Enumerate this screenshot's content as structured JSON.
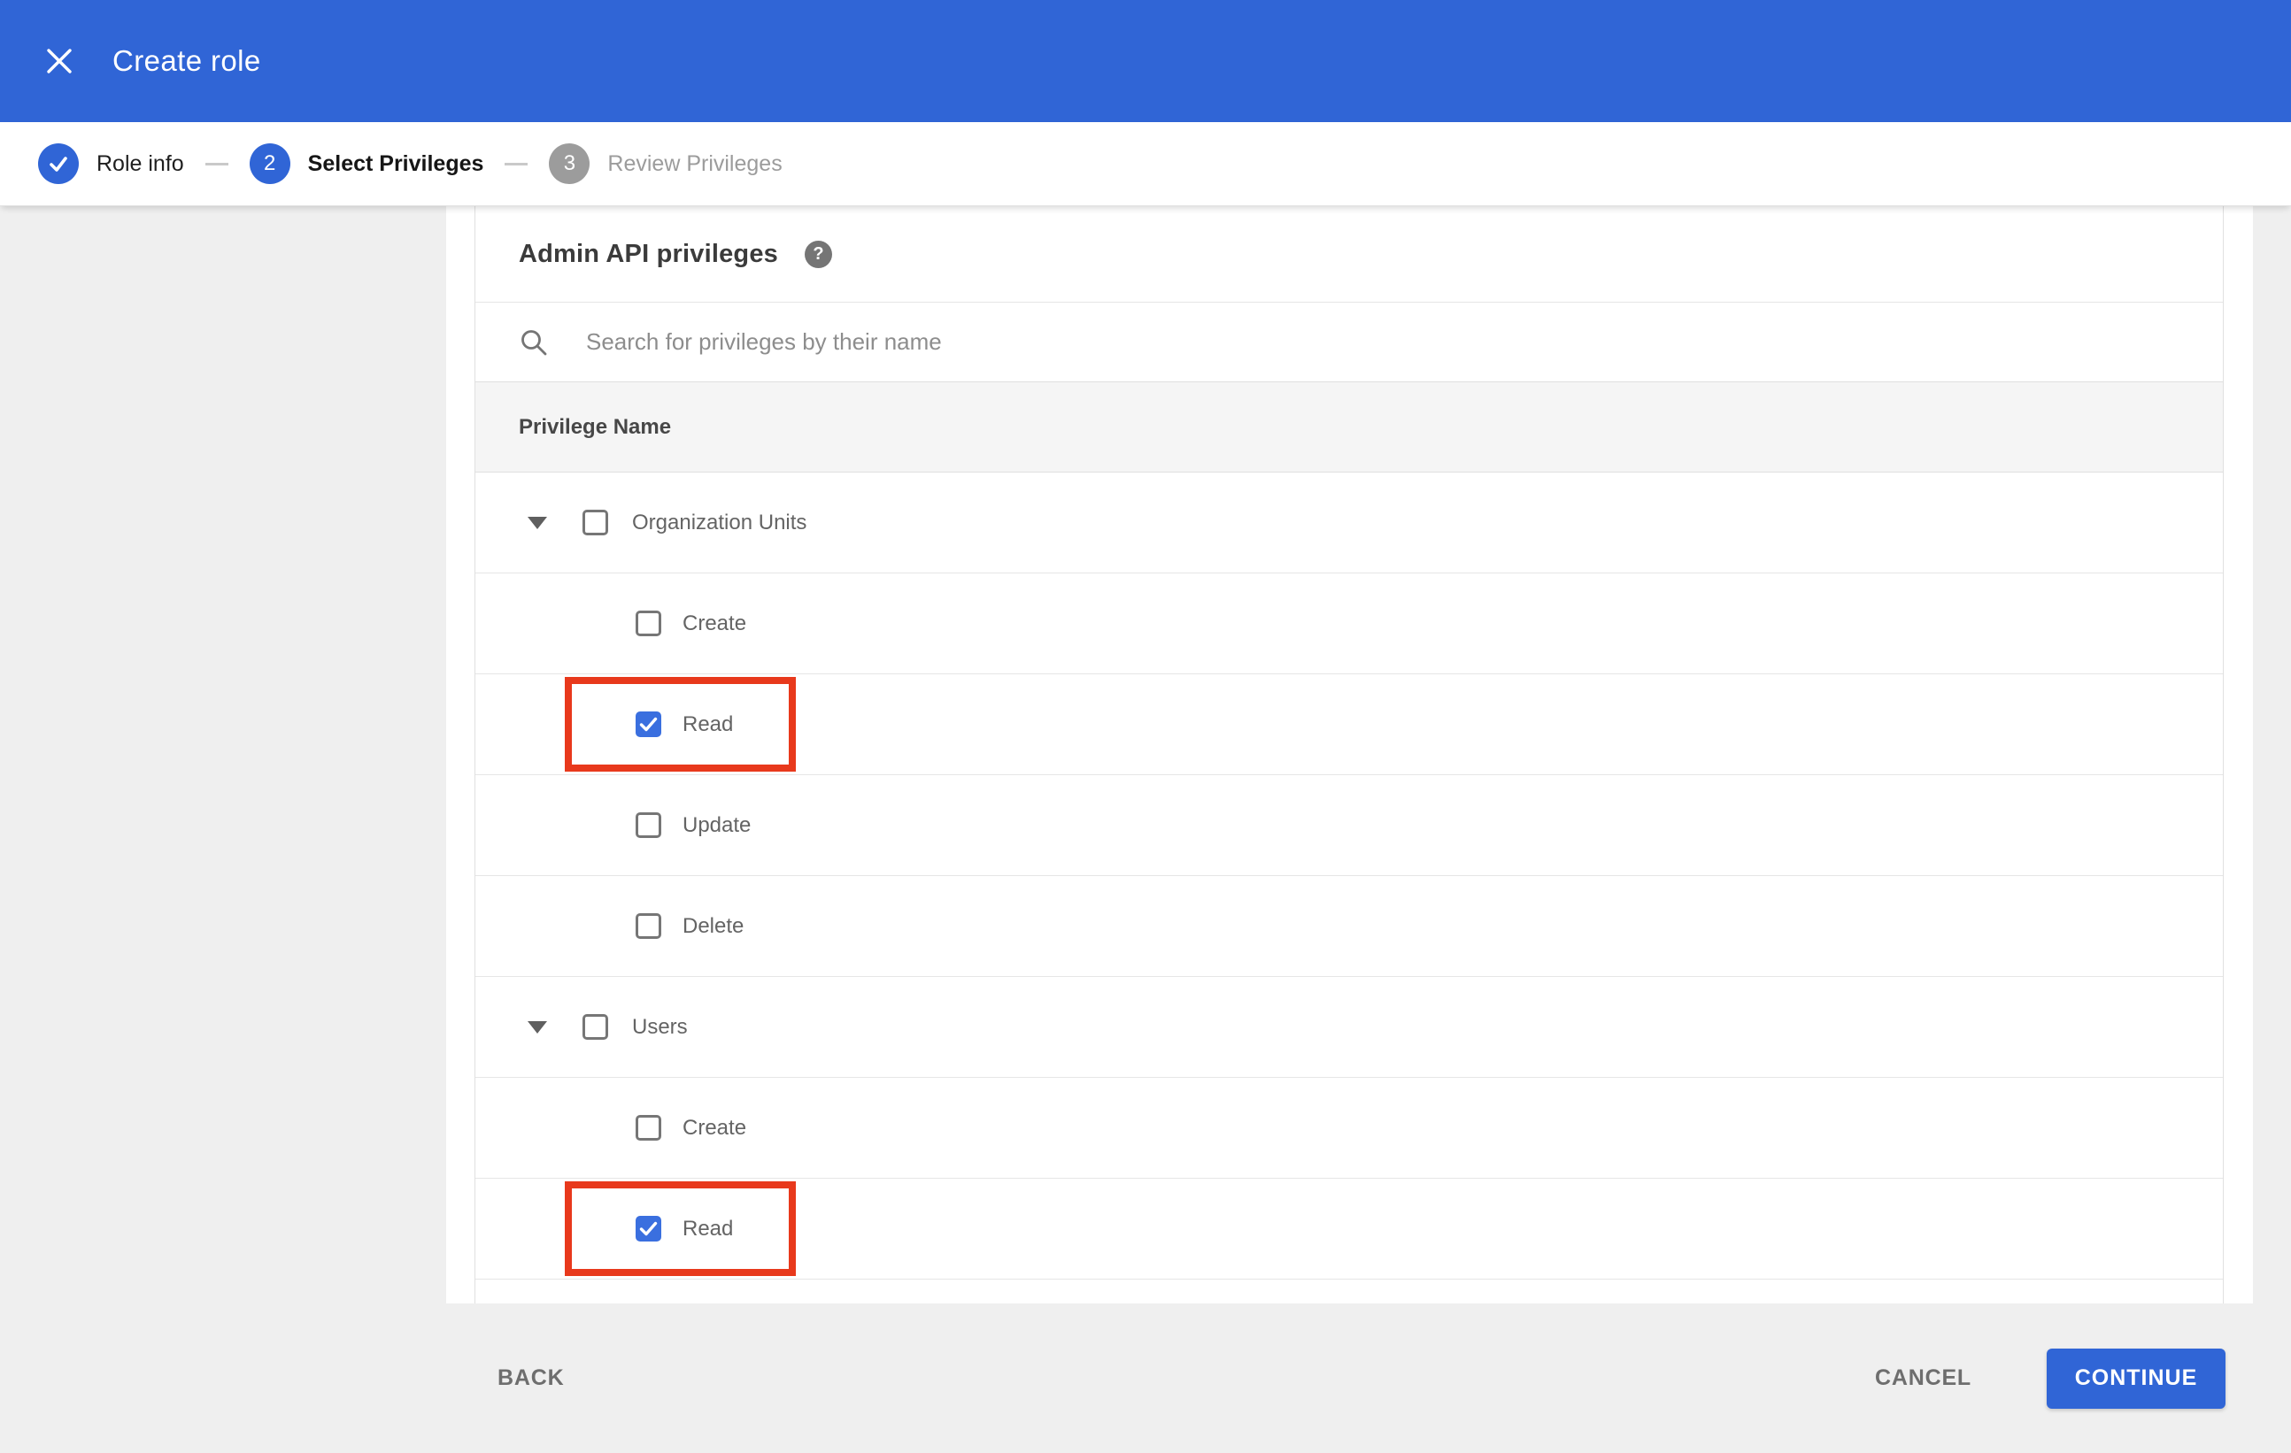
{
  "header": {
    "title": "Create role"
  },
  "stepper": {
    "steps": [
      {
        "label": "Role info",
        "state": "complete",
        "number": ""
      },
      {
        "label": "Select Privileges",
        "state": "active",
        "number": "2"
      },
      {
        "label": "Review Privileges",
        "state": "upcoming",
        "number": "3"
      }
    ]
  },
  "panel": {
    "title": "Admin API privileges",
    "help_icon": "?",
    "search_placeholder": "Search for privileges by their name",
    "table_header": "Privilege Name",
    "groups": [
      {
        "label": "Organization Units",
        "checked": false,
        "expanded": true,
        "children": [
          {
            "label": "Create",
            "checked": false,
            "highlighted": false
          },
          {
            "label": "Read",
            "checked": true,
            "highlighted": true
          },
          {
            "label": "Update",
            "checked": false,
            "highlighted": false
          },
          {
            "label": "Delete",
            "checked": false,
            "highlighted": false
          }
        ]
      },
      {
        "label": "Users",
        "checked": false,
        "expanded": true,
        "children": [
          {
            "label": "Create",
            "checked": false,
            "highlighted": false
          },
          {
            "label": "Read",
            "checked": true,
            "highlighted": true
          }
        ]
      }
    ]
  },
  "footer": {
    "back_label": "BACK",
    "cancel_label": "CANCEL",
    "continue_label": "CONTINUE"
  },
  "colors": {
    "primary_blue": "#3065d6",
    "checkbox_checked_blue": "#3a6fdf",
    "annotation_red": "#e8391c",
    "footer_gray": "#efefef",
    "table_header_gray": "#f5f5f5"
  }
}
